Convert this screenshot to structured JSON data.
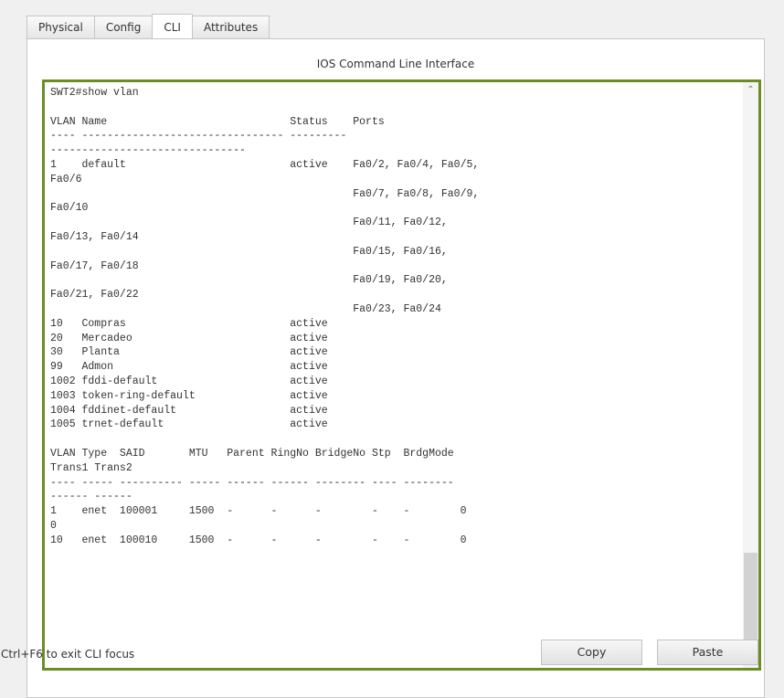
{
  "tabs": [
    {
      "label": "Physical"
    },
    {
      "label": "Config"
    },
    {
      "label": "CLI"
    },
    {
      "label": "Attributes"
    }
  ],
  "panel": {
    "title": "IOS Command Line Interface"
  },
  "cli": {
    "lines": [
      "SWT2#show vlan",
      "",
      "VLAN Name                             Status    Ports",
      "---- -------------------------------- ---------",
      "-------------------------------",
      "1    default                          active    Fa0/2, Fa0/4, Fa0/5,",
      "Fa0/6",
      "                                                Fa0/7, Fa0/8, Fa0/9,",
      "Fa0/10",
      "                                                Fa0/11, Fa0/12,",
      "Fa0/13, Fa0/14",
      "                                                Fa0/15, Fa0/16,",
      "Fa0/17, Fa0/18",
      "                                                Fa0/19, Fa0/20,",
      "Fa0/21, Fa0/22",
      "                                                Fa0/23, Fa0/24",
      "10   Compras                          active",
      "20   Mercadeo                         active",
      "30   Planta                           active",
      "99   Admon                            active",
      "1002 fddi-default                     active",
      "1003 token-ring-default               active",
      "1004 fddinet-default                  active",
      "1005 trnet-default                    active",
      "",
      "VLAN Type  SAID       MTU   Parent RingNo BridgeNo Stp  BrdgMode",
      "Trans1 Trans2",
      "---- ----- ---------- ----- ------ ------ -------- ---- --------",
      "------ ------",
      "1    enet  100001     1500  -      -      -        -    -        0",
      "0",
      "10   enet  100010     1500  -      -      -        -    -        0"
    ]
  },
  "footer": {
    "status": "Ctrl+F6 to exit CLI focus",
    "copy_label": "Copy",
    "paste_label": "Paste"
  },
  "icons": {
    "scroll_up": "chevron-up-icon",
    "scroll_down": "chevron-down-icon"
  },
  "colors": {
    "cli_border": "#6b8e23"
  }
}
